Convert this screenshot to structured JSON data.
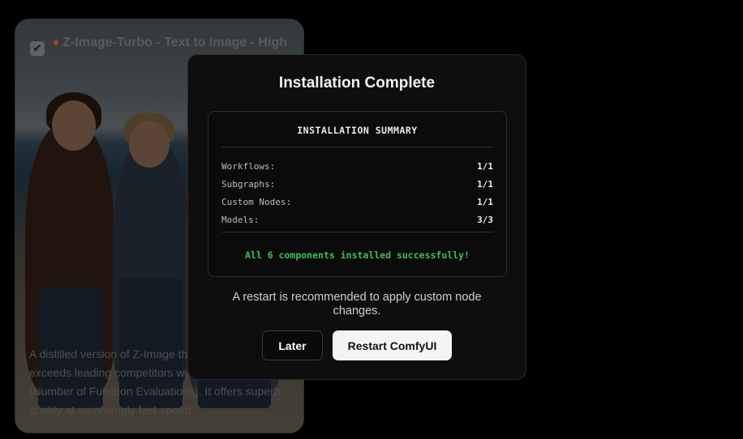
{
  "background_card": {
    "title": "Z-Image-Turbo - Text to Image - High",
    "checkbox_mark": "✔",
    "icon": "flame-icon",
    "description": "A distilled version of Z-Image that matches or exceeds leading competitors with only 8 NFEs (Number of Function Evaluations). It offers superb quality at surprisingly fast speed."
  },
  "modal": {
    "title": "Installation Complete",
    "summary": {
      "heading": "INSTALLATION SUMMARY",
      "rows": [
        {
          "label": "Workflows:",
          "value": "1/1"
        },
        {
          "label": "Subgraphs:",
          "value": "1/1"
        },
        {
          "label": "Custom Nodes:",
          "value": "1/1"
        },
        {
          "label": "Models:",
          "value": "3/3"
        }
      ],
      "success_message": "All 6 components installed successfully!"
    },
    "restart_note": "A restart is recommended to apply custom node changes.",
    "buttons": {
      "later": "Later",
      "restart": "Restart ComfyUI"
    }
  },
  "colors": {
    "modal_background": "#0e0e0e",
    "success_text": "#3fbf5a",
    "primary_button": "#f4f4f4"
  }
}
